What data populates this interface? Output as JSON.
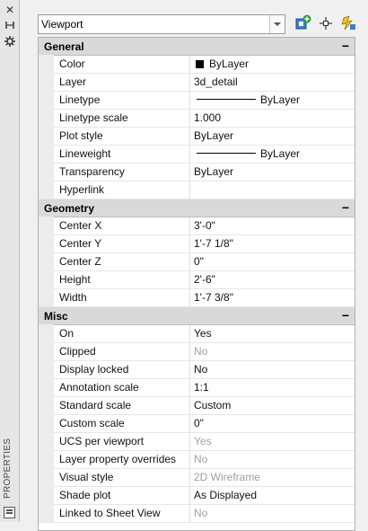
{
  "palette": {
    "vertical_title": "PROPERTIES"
  },
  "selector": {
    "value": "Viewport"
  },
  "sections": {
    "general": {
      "title": "General",
      "collapse_symbol": "−",
      "rows": [
        {
          "name": "Color",
          "value": "ByLayer"
        },
        {
          "name": "Layer",
          "value": "3d_detail"
        },
        {
          "name": "Linetype",
          "value": "ByLayer"
        },
        {
          "name": "Linetype scale",
          "value": "1.000"
        },
        {
          "name": "Plot style",
          "value": "ByLayer"
        },
        {
          "name": "Lineweight",
          "value": "ByLayer"
        },
        {
          "name": "Transparency",
          "value": "ByLayer"
        },
        {
          "name": "Hyperlink",
          "value": ""
        }
      ]
    },
    "geometry": {
      "title": "Geometry",
      "collapse_symbol": "−",
      "rows": [
        {
          "name": "Center X",
          "value": "3'-0\""
        },
        {
          "name": "Center Y",
          "value": "1'-7 1/8\""
        },
        {
          "name": "Center Z",
          "value": "0\""
        },
        {
          "name": "Height",
          "value": "2'-6\""
        },
        {
          "name": "Width",
          "value": "1'-7 3/8\""
        }
      ]
    },
    "misc": {
      "title": "Misc",
      "collapse_symbol": "−",
      "rows": [
        {
          "name": "On",
          "value": "Yes"
        },
        {
          "name": "Clipped",
          "value": "No"
        },
        {
          "name": "Display locked",
          "value": "No"
        },
        {
          "name": "Annotation scale",
          "value": "1:1"
        },
        {
          "name": "Standard scale",
          "value": "Custom"
        },
        {
          "name": "Custom scale",
          "value": "0\""
        },
        {
          "name": "UCS per viewport",
          "value": "Yes"
        },
        {
          "name": "Layer property overrides",
          "value": "No"
        },
        {
          "name": "Visual style",
          "value": "2D Wireframe"
        },
        {
          "name": "Shade plot",
          "value": "As Displayed"
        },
        {
          "name": "Linked to Sheet View",
          "value": "No"
        }
      ]
    }
  }
}
